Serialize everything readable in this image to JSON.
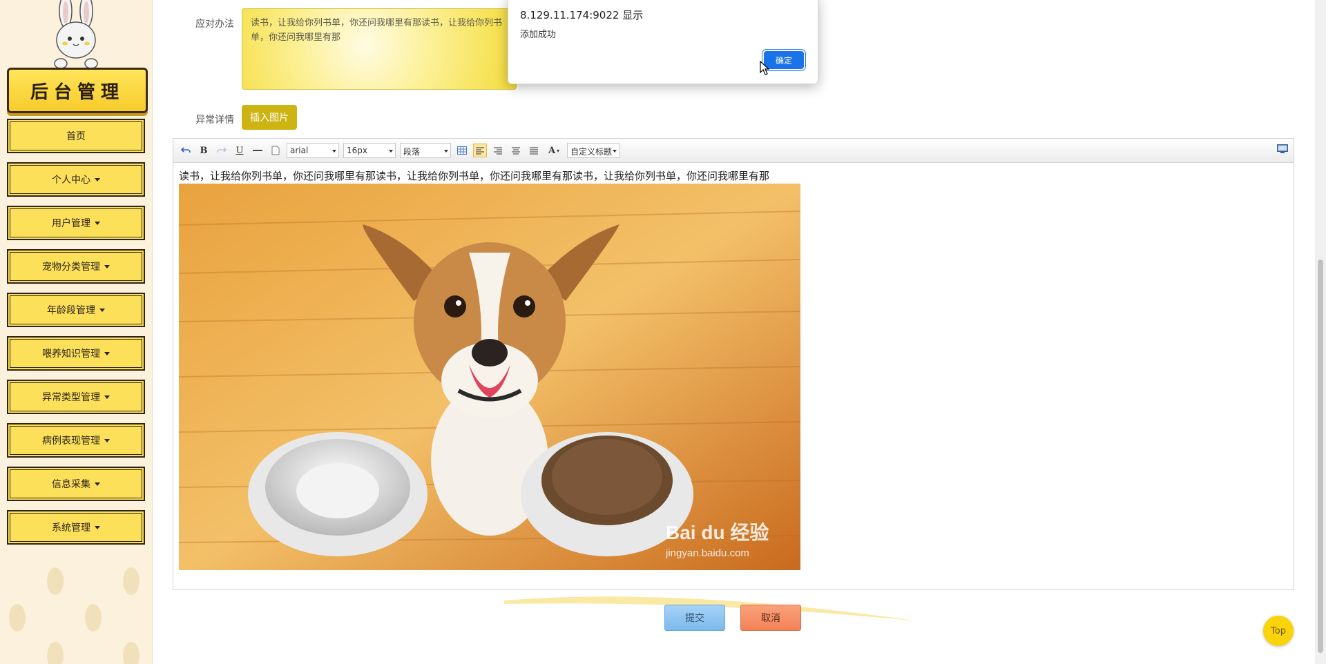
{
  "sidebar": {
    "logo_text": "后台管理",
    "items": [
      {
        "label": "首页",
        "dropdown": false
      },
      {
        "label": "个人中心",
        "dropdown": true
      },
      {
        "label": "用户管理",
        "dropdown": true
      },
      {
        "label": "宠物分类管理",
        "dropdown": true
      },
      {
        "label": "年龄段管理",
        "dropdown": true
      },
      {
        "label": "喂养知识管理",
        "dropdown": true
      },
      {
        "label": "异常类型管理",
        "dropdown": true
      },
      {
        "label": "病例表现管理",
        "dropdown": true
      },
      {
        "label": "信息采集",
        "dropdown": true
      },
      {
        "label": "系统管理",
        "dropdown": true
      }
    ]
  },
  "form": {
    "solution_label": "应对办法",
    "solution_value": "读书，让我给你列书单，你还问我哪里有那读书，让我给你列书单，你还问我哪里有那",
    "detail_label": "异常详情",
    "insert_image_label": "插入图片"
  },
  "editor": {
    "font_family": "arial",
    "font_size": "16px",
    "paragraph": "段落",
    "custom_title": "自定义标题",
    "content_text": "读书，让我给你列书单，你还问我哪里有那读书，让我给你列书单，你还问我哪里有那读书，让我给你列书单，你还问我哪里有那",
    "image_watermark": "Bai du 经验",
    "image_watermark_url": "jingyan.baidu.com"
  },
  "actions": {
    "submit_label": "提交",
    "cancel_label": "取消",
    "top_label": "Top"
  },
  "dialog": {
    "title": "8.129.11.174:9022 显示",
    "message": "添加成功",
    "ok_label": "确定"
  },
  "colors": {
    "sidebar_bg": "#fbf1dc",
    "nav_yellow": "#fde05a",
    "accent_gold": "#cdb413",
    "dialog_blue": "#1a73e8"
  }
}
